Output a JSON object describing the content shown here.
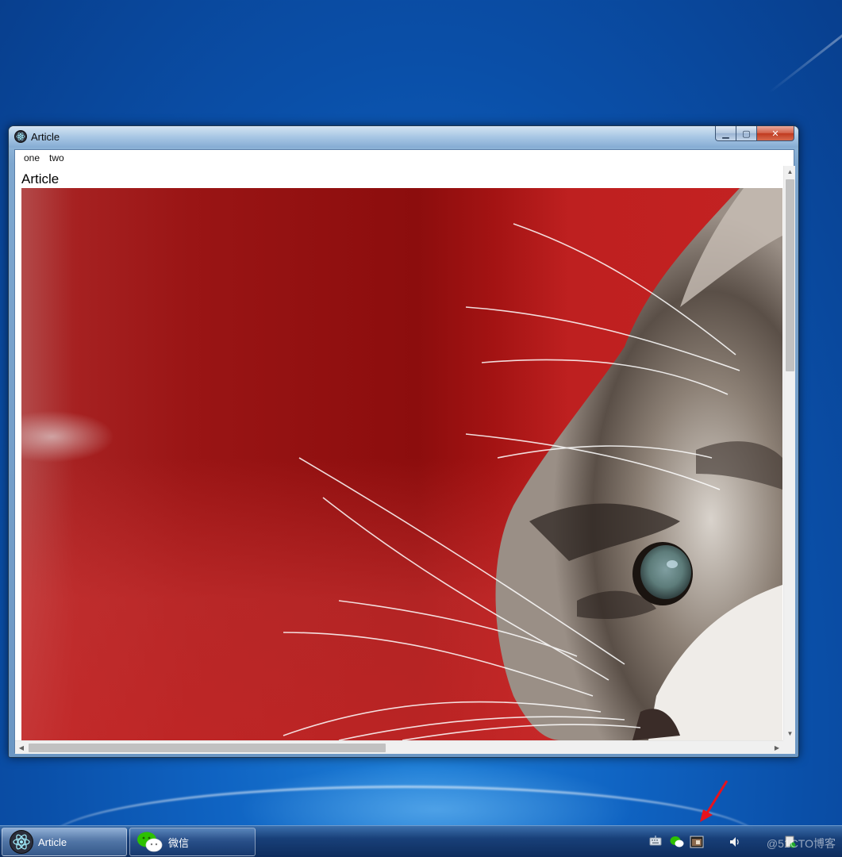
{
  "window": {
    "title": "Article",
    "icon": "electron-icon",
    "caption": {
      "minimize": "minimize-icon",
      "maximize": "maximize-icon",
      "close": "close-icon"
    }
  },
  "menu": {
    "items": [
      "one",
      "two"
    ]
  },
  "content": {
    "heading": "Article",
    "image": "kitten-photo"
  },
  "taskbar": {
    "buttons": [
      {
        "label": "Article",
        "icon": "electron-icon"
      },
      {
        "label": "微信",
        "icon": "wechat-icon"
      }
    ],
    "tray_icons": [
      "keyboard-icon",
      "wechat-tray-icon",
      "app-tray-icon",
      "volume-icon",
      "action-center-icon"
    ],
    "watermark": "@51CTO博客"
  },
  "colors": {
    "desktop": "#0f63c2",
    "photo_background": "#a31313",
    "annotation_arrow": "#e8121c"
  }
}
